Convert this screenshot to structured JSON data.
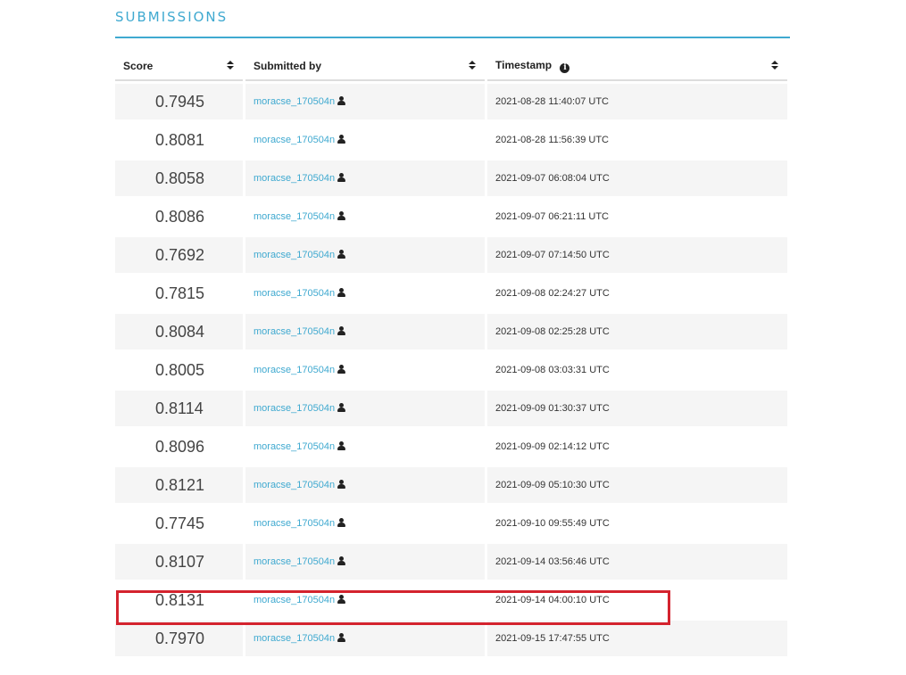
{
  "section_title": "SUBMISSIONS",
  "columns": {
    "score": "Score",
    "submitted_by": "Submitted by",
    "timestamp": "Timestamp"
  },
  "icons": {
    "sort": "sort-icon",
    "info": "info-icon",
    "user": "user-icon"
  },
  "colors": {
    "accent": "#3fa9d0",
    "highlight": "#d4232e"
  },
  "rows": [
    {
      "score": "0.7945",
      "user": "moracse_170504n",
      "timestamp": "2021-08-28 11:40:07 UTC"
    },
    {
      "score": "0.8081",
      "user": "moracse_170504n",
      "timestamp": "2021-08-28 11:56:39 UTC"
    },
    {
      "score": "0.8058",
      "user": "moracse_170504n",
      "timestamp": "2021-09-07 06:08:04 UTC"
    },
    {
      "score": "0.8086",
      "user": "moracse_170504n",
      "timestamp": "2021-09-07 06:21:11 UTC"
    },
    {
      "score": "0.7692",
      "user": "moracse_170504n",
      "timestamp": "2021-09-07 07:14:50 UTC"
    },
    {
      "score": "0.7815",
      "user": "moracse_170504n",
      "timestamp": "2021-09-08 02:24:27 UTC"
    },
    {
      "score": "0.8084",
      "user": "moracse_170504n",
      "timestamp": "2021-09-08 02:25:28 UTC"
    },
    {
      "score": "0.8005",
      "user": "moracse_170504n",
      "timestamp": "2021-09-08 03:03:31 UTC"
    },
    {
      "score": "0.8114",
      "user": "moracse_170504n",
      "timestamp": "2021-09-09 01:30:37 UTC"
    },
    {
      "score": "0.8096",
      "user": "moracse_170504n",
      "timestamp": "2021-09-09 02:14:12 UTC"
    },
    {
      "score": "0.8121",
      "user": "moracse_170504n",
      "timestamp": "2021-09-09 05:10:30 UTC"
    },
    {
      "score": "0.7745",
      "user": "moracse_170504n",
      "timestamp": "2021-09-10 09:55:49 UTC"
    },
    {
      "score": "0.8107",
      "user": "moracse_170504n",
      "timestamp": "2021-09-14 03:56:46 UTC"
    },
    {
      "score": "0.8131",
      "user": "moracse_170504n",
      "timestamp": "2021-09-14 04:00:10 UTC",
      "highlighted": true
    },
    {
      "score": "0.7970",
      "user": "moracse_170504n",
      "timestamp": "2021-09-15 17:47:55 UTC"
    }
  ]
}
